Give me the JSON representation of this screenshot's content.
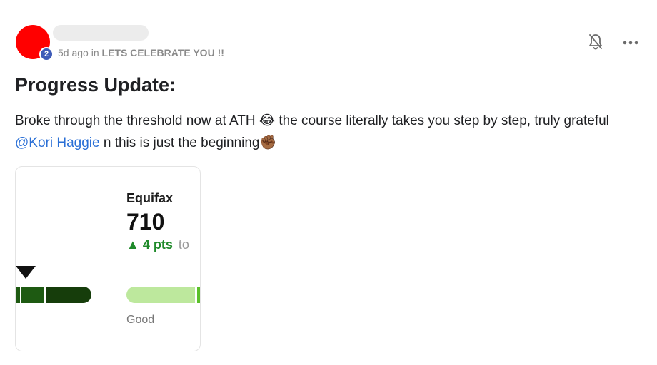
{
  "post": {
    "level": "2",
    "time_ago": "5d ago",
    "in_word": "in",
    "category": "LETS CELEBRATE YOU !!",
    "title": "Progress Update:",
    "body_part1": "Broke through the threshold now at ATH",
    "emoji1": "😂",
    "body_part2": "the course literally takes you step by step, truly grateful",
    "mention": "@Kori Haggie",
    "body_part3": "n this is just the beginning",
    "emoji2": "✊🏾",
    "icons": {
      "bell": "bell-muted-icon",
      "more": "more-horizontal-icon"
    }
  },
  "attachment": {
    "bureau": "Equifax",
    "score": "710",
    "change_arrow": "▲",
    "change": "4 pts",
    "change_suffix": "to",
    "rating": "Good",
    "colors": {
      "dark_green": "#1e5a12",
      "darker_green": "#163d0b",
      "light_green": "#bde89d",
      "bright_green": "#5ac02a",
      "up_green": "#1f8a2a",
      "mention_blue": "#2a6fd6",
      "level_badge": "#3e5bb8"
    }
  }
}
